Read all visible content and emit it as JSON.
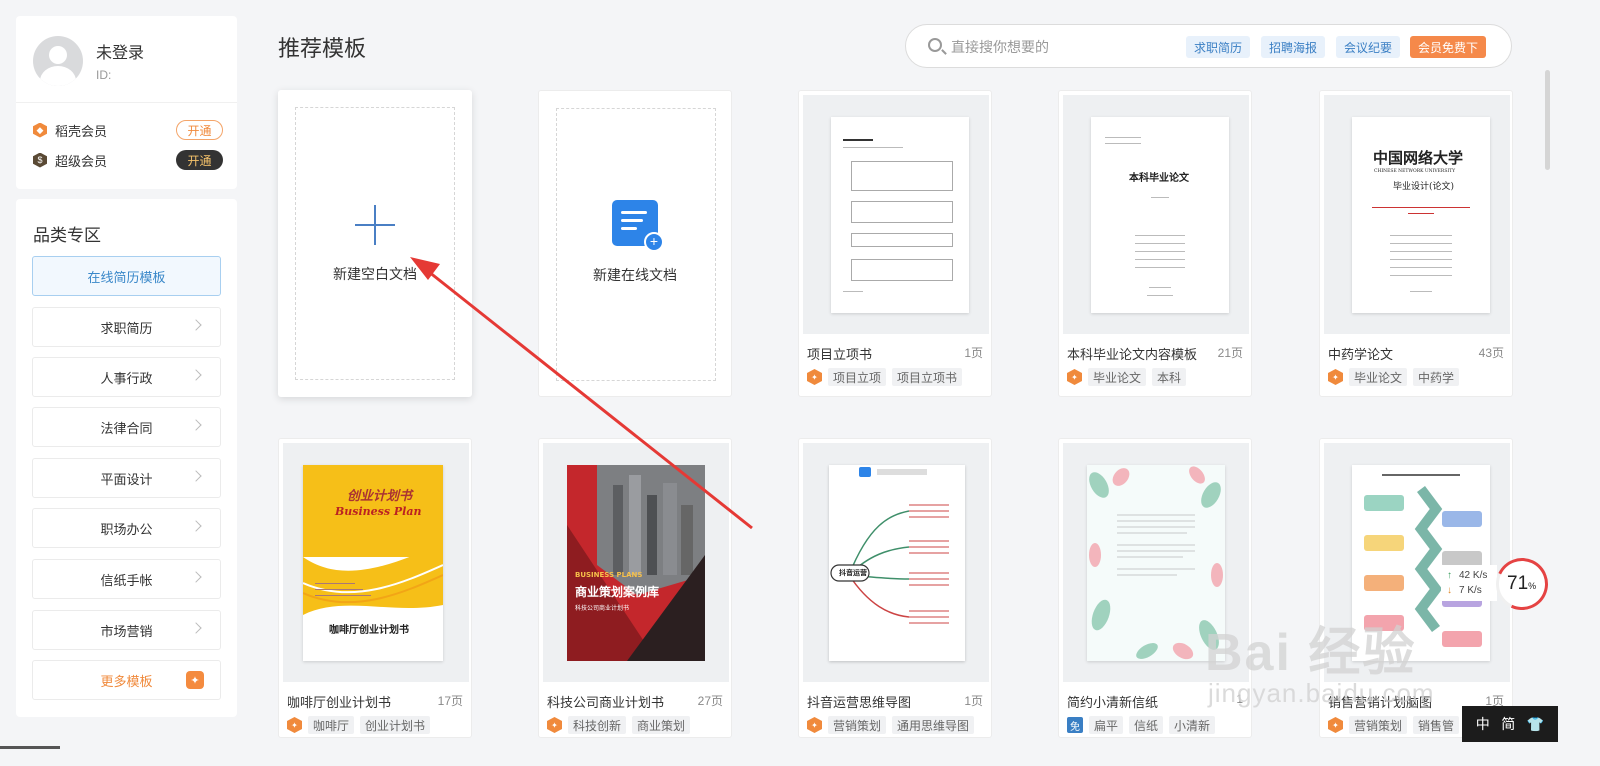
{
  "user": {
    "name": "未登录",
    "id_label": "ID:",
    "vip_rows": [
      {
        "label": "稻壳会员",
        "button": "开通",
        "color": "#f08a3c"
      },
      {
        "label": "超级会员",
        "button": "开通",
        "color": "#5a4a35"
      }
    ]
  },
  "categories": {
    "title": "品类专区",
    "active": "在线简历模板",
    "items": [
      "求职简历",
      "人事行政",
      "法律合同",
      "平面设计",
      "职场办公",
      "信纸手帐",
      "市场营销"
    ],
    "more": "更多模板"
  },
  "header": {
    "title": "推荐模板",
    "search_placeholder": "直接搜你想要的",
    "tags": [
      "求职简历",
      "招聘海报",
      "会议纪要"
    ],
    "vip_tag": "会员免费下"
  },
  "create": {
    "blank": "新建空白文档",
    "online": "新建在线文档"
  },
  "templates": [
    {
      "title": "项目立项书",
      "pages": "1页",
      "tags": [
        "项目立项",
        "项目立项书"
      ],
      "badge": "wps"
    },
    {
      "title": "本科毕业论文内容模板",
      "pages": "21页",
      "tags": [
        "毕业论文",
        "本科"
      ],
      "badge": "wps"
    },
    {
      "title": "中药学论文",
      "pages": "43页",
      "tags": [
        "毕业论文",
        "中药学"
      ],
      "badge": "wps"
    },
    {
      "title": "咖啡厅创业计划书",
      "pages": "17页",
      "tags": [
        "咖啡厅",
        "创业计划书"
      ],
      "badge": "wps"
    },
    {
      "title": "科技公司商业计划书",
      "pages": "27页",
      "tags": [
        "科技创新",
        "商业策划"
      ],
      "badge": "wps"
    },
    {
      "title": "抖音运营思维导图",
      "pages": "1页",
      "tags": [
        "营销策划",
        "通用思维导图"
      ],
      "badge": "wps"
    },
    {
      "title": "简约小清新信纸",
      "pages": "1",
      "tags": [
        "扁平",
        "信纸",
        "小清新"
      ],
      "badge": "免"
    },
    {
      "title": "销售营销计划脑图",
      "pages": "1页",
      "tags": [
        "营销策划",
        "销售管"
      ],
      "badge": "wps"
    }
  ],
  "thumbs": {
    "thesis_heading": "本科毕业论文",
    "university": "中国网络大学",
    "university_en": "CHINESE NETWORK UNIVERSITY",
    "design_label": "毕业设计(论文)",
    "cafe_script": "创业计划书",
    "cafe_en": "Business Plan",
    "cafe_title": "咖啡厅创业计划书",
    "red_en": "BUSINESS PLANS",
    "red_title": "商业策划案例库",
    "red_sub": "科技公司商业计划书",
    "mind_center": "抖音运营"
  },
  "widgets": {
    "up_speed": "42  K/s",
    "down_speed": "7  K/s",
    "gauge": "71",
    "gauge_unit": "%",
    "ime_label": "中",
    "ime_mode": "简",
    "watermark": "Bai 经验",
    "watermark_sub": "jingyan.baidu.com"
  },
  "colors": {
    "accent": "#3a88c9",
    "orange": "#f08a3c",
    "arrow": "#e53935"
  }
}
